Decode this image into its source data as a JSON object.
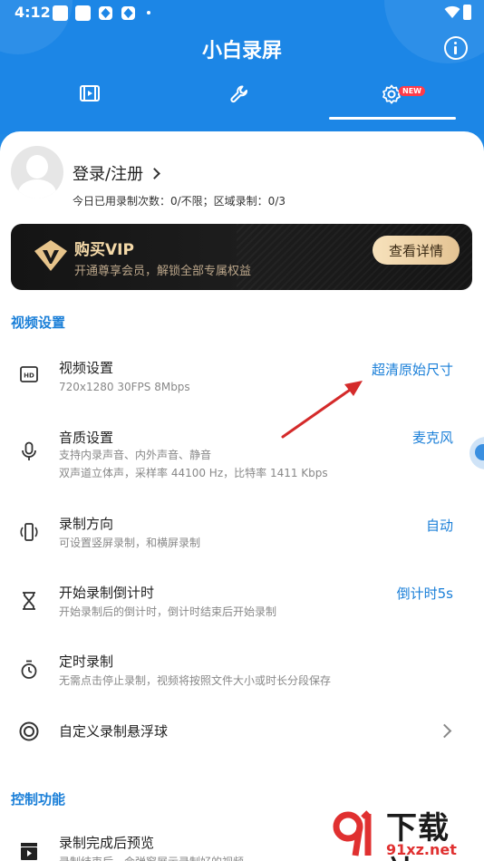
{
  "status_bar": {
    "time": "4:12"
  },
  "header": {
    "title": "小白录屏",
    "new_badge": "NEW"
  },
  "tabs": [
    {
      "icon": "video-list-icon",
      "active": false
    },
    {
      "icon": "wrench-icon",
      "active": false
    },
    {
      "icon": "settings-gear-icon",
      "active": true,
      "badge": "NEW"
    }
  ],
  "account": {
    "login_label": "登录/注册",
    "usage_text": "今日已用录制次数：0/不限；区域录制：0/3"
  },
  "vip": {
    "title": "购买VIP",
    "subtitle": "开通尊享会员，解锁全部专属权益",
    "button_label": "查看详情"
  },
  "sections": {
    "video": {
      "title": "视频设置"
    },
    "control": {
      "title": "控制功能"
    }
  },
  "rows": {
    "video_settings": {
      "icon": "hd-icon",
      "title": "视频设置",
      "subtitle": "720x1280  30FPS  8Mbps",
      "value": "超清原始尺寸"
    },
    "audio_settings": {
      "icon": "microphone-icon",
      "title": "音质设置",
      "subtitle_1": "支持内录声音、内外声音、静音",
      "subtitle_2": "双声道立体声，采样率 44100 Hz，比特率 1411 Kbps",
      "value": "麦克风"
    },
    "orientation": {
      "icon": "rotate-phone-icon",
      "title": "录制方向",
      "subtitle": "可设置竖屏录制，和横屏录制",
      "value": "自动"
    },
    "countdown": {
      "icon": "hourglass-icon",
      "title": "开始录制倒计时",
      "subtitle": "开始录制后的倒计时，倒计时结束后开始录制",
      "value": "倒计时5s"
    },
    "timer": {
      "icon": "stopwatch-icon",
      "title": "定时录制",
      "subtitle": "无需点击停止录制，视频将按照文件大小或时长分段保存"
    },
    "float_ball": {
      "icon": "target-icon",
      "title": "自定义录制悬浮球"
    },
    "preview": {
      "icon": "clapperboard-icon",
      "title": "录制完成后预览",
      "subtitle": "录制结束后，会弹窗展示录制好的视频"
    }
  },
  "watermark": {
    "big": "下载站",
    "small": "91xz.net"
  },
  "colors": {
    "brand_blue": "#1c86e6",
    "accent_blue": "#1a7fd8",
    "arrow_red": "#d42a2a",
    "vip_gold": "#f4d9a8"
  }
}
